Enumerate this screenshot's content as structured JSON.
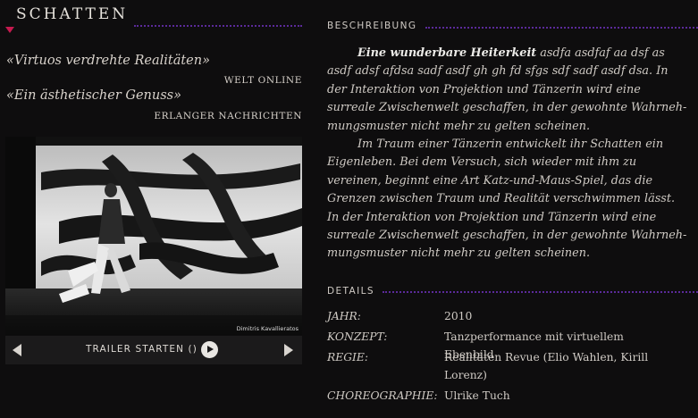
{
  "page": {
    "title": "SCHATTEN"
  },
  "quotes": [
    {
      "text": "«Virtuos verdrehte Realitäten»",
      "source": "WELT ONLINE"
    },
    {
      "text": "«Ein ästhetischer Genuss»",
      "source": "ERLANGER NACHRICHTEN"
    }
  ],
  "media": {
    "photo_credit": "Dimitris Kavallieratos",
    "trailer_label": "TRAILER STARTEN ()",
    "prev_icon": "chevron-left-icon",
    "next_icon": "chevron-right-icon",
    "play_icon": "play-icon"
  },
  "description": {
    "heading": "BESCHREIBUNG",
    "lead": "Eine wunderbare Heiterkeit",
    "p1_rest": " asdfa asdfaf aa dsf as asdf adsf afdsa sadf asdf gh gh fd sfgs sdf sadf asdf dsa. In der Interaktion von Projektion und Tänzerin wird eine surreale Zwischenwelt geschaffen, in der gewohnte Wahrneh-mungsmuster nicht mehr zu gelten scheinen.",
    "p2": "Im Traum einer Tänzerin entwickelt ihr Schatten ein Eigenleben. Bei dem Versuch, sich wieder mit ihm zu vereinen, beginnt eine Art Katz-und-Maus-Spiel, das die Grenzen zwischen Traum und Realität verschwimmen lässt.",
    "p3": "In der Interaktion von Projektion und Tänzerin wird eine surreale Zwischenwelt geschaffen, in der gewohnte Wahrneh-mungsmuster nicht mehr zu gelten scheinen."
  },
  "details": {
    "heading": "DETAILS",
    "rows": [
      {
        "key": "JAHR:",
        "value": "2010"
      },
      {
        "key": "KONZEPT:",
        "value": "Tanzperformance mit virtuellem Ebenbild"
      },
      {
        "key": "REGIE:",
        "value": "Realitäten Revue (Elio Wahlen, Kirill Lorenz)"
      },
      {
        "key": "CHOREOGRAPHIE:",
        "value": "Ulrike Tuch"
      }
    ]
  },
  "colors": {
    "background": "#0e0d0e",
    "accent_rule": "#5b2a9a",
    "marker": "#c61a4f",
    "text": "#cfcac4"
  }
}
